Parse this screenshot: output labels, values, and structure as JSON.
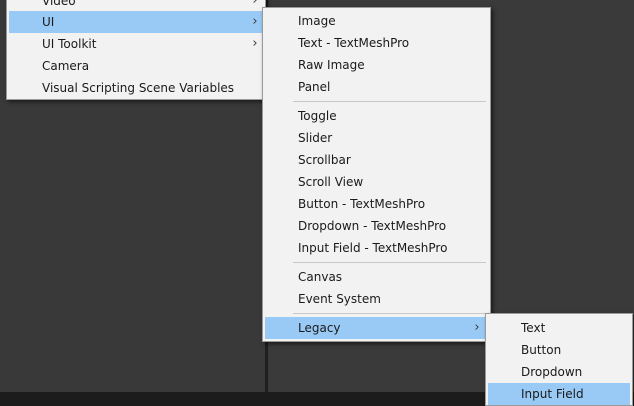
{
  "menu_main": {
    "items": [
      {
        "label": "Video",
        "has_submenu": true
      },
      {
        "label": "UI",
        "has_submenu": true,
        "highlighted": true
      },
      {
        "label": "UI Toolkit",
        "has_submenu": true
      },
      {
        "label": "Camera",
        "has_submenu": false
      },
      {
        "label": "Visual Scripting Scene Variables",
        "has_submenu": false
      }
    ]
  },
  "menu_ui": {
    "group1": [
      "Image",
      "Text - TextMeshPro",
      "Raw Image",
      "Panel"
    ],
    "group2": [
      "Toggle",
      "Slider",
      "Scrollbar",
      "Scroll View",
      "Button - TextMeshPro",
      "Dropdown - TextMeshPro",
      "Input Field - TextMeshPro"
    ],
    "group3": [
      "Canvas",
      "Event System"
    ],
    "legacy": {
      "label": "Legacy",
      "has_submenu": true,
      "highlighted": true
    }
  },
  "menu_legacy": {
    "items": [
      {
        "label": "Text"
      },
      {
        "label": "Button"
      },
      {
        "label": "Dropdown"
      },
      {
        "label": "Input Field",
        "highlighted": true
      }
    ]
  },
  "icons": {
    "submenu_arrow": "chevron-right-icon",
    "submenu_arrow_glyph": "›"
  },
  "colors": {
    "menu_background": "#f2f2f2",
    "highlight": "#99c9f5",
    "editor_background": "#393939",
    "panel_divider": "#1f1f1f"
  }
}
